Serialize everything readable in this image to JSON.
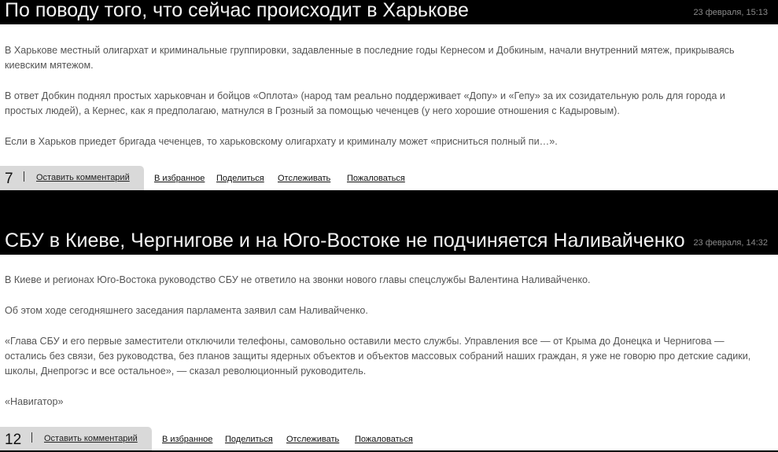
{
  "posts": [
    {
      "title": "По поводу того, что сейчас происходит в Харькове",
      "date": "23 февраля, 15:13",
      "paragraphs": [
        "В Харькове местный олигархат и криминальные группировки, задавленные в последние годы Кернесом и Добкиным, начали внутренний мятеж, прикрываясь киевским мятежом.",
        "В ответ Добкин поднял простых харьковчан и бойцов «Оплота» (народ там реально поддерживает «Допу» и «Гепу» за их созидательную роль для города и простых людей), а Кернес, как я предполагаю, матнулся в Грозный за помощью чеченцев (у него хорошие отношения с Кадыровым).",
        "Если в Харьков приедет бригада чеченцев, то харьковскому олигархату и криминалу может «присниться полный пи…»."
      ],
      "comment_count": "7",
      "comment_link": "Оставить комментарий",
      "actions": [
        "В избранное",
        "Поделиться",
        "Отслеживать",
        "Пожаловаться"
      ]
    },
    {
      "title": "СБУ в Киеве, Чергнигове и на Юго-Востоке не подчиняется Наливайченко",
      "date": "23 февраля, 14:32",
      "paragraphs": [
        "В Киеве и регионах Юго-Востока руководство СБУ не ответило на звонки нового главы спецслужбы Валентина Наливайченко.",
        "Об этом ходе сегодняшнего заседания парламента заявил сам Наливайченко.",
        "«Глава СБУ и его первые заместители отключили телефоны, самовольно оставили место службы. Управления все — от Крыма до Донецка и Чернигова — остались без связи, без руководства, без планов защиты ядерных объектов и объектов массовых собраний наших граждан, я уже не говорю про детские садики, школы, Днепрогэс и все остальное», — сказал революционный руководитель.",
        "«Навигатор»"
      ],
      "comment_count": "12",
      "comment_link": "Оставить комментарий",
      "actions": [
        "В избранное",
        "Поделиться",
        "Отслеживать",
        "Пожаловаться"
      ]
    }
  ]
}
